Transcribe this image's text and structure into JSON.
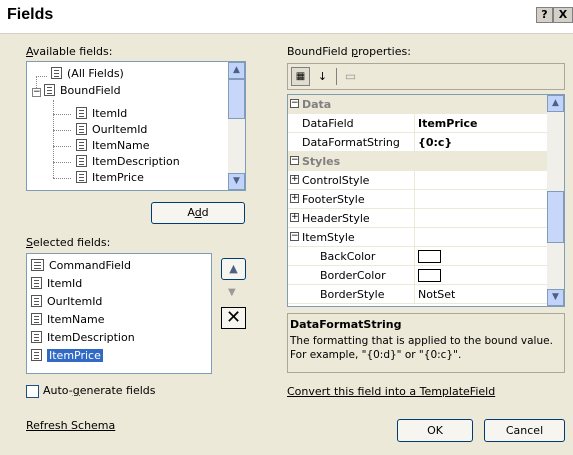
{
  "window": {
    "title": "Fields",
    "help_glyph": "?",
    "close_glyph": "X"
  },
  "available": {
    "label_accel": "A",
    "label_rest": "vailable fields:",
    "items": [
      "(All Fields)",
      "BoundField",
      "ItemId",
      "OurItemId",
      "ItemName",
      "ItemDescription",
      "ItemPrice"
    ],
    "add_pre": "A",
    "add_accel": "d",
    "add_post": "d"
  },
  "selected": {
    "label_accel": "S",
    "label_rest": "elected fields:",
    "items": [
      "CommandField",
      "ItemId",
      "OurItemId",
      "ItemName",
      "ItemDescription",
      "ItemPrice"
    ]
  },
  "autogen": {
    "pre": "Auto-",
    "accel": "g",
    "post": "enerate fields",
    "checked": false
  },
  "refresh_schema": "Refresh Schema",
  "properties": {
    "label_pre": "BoundField ",
    "label_accel": "p",
    "label_post": "roperties:",
    "rows": {
      "cat_data": "Data",
      "datafield_name": "DataField",
      "datafield_value": "ItemPrice",
      "dfs_name": "DataFormatString",
      "dfs_value": "{0:c}",
      "cat_styles": "Styles",
      "controlstyle": "ControlStyle",
      "footerstyle": "FooterStyle",
      "headerstyle": "HeaderStyle",
      "itemstyle": "ItemStyle",
      "backcolor": "BackColor",
      "bordercolor": "BorderColor",
      "borderstyle_name": "BorderStyle",
      "borderstyle_value": "NotSet"
    }
  },
  "description": {
    "title": "DataFormatString",
    "text": "The formatting that is applied to the bound value. For example, \"{0:d}\" or \"{0:c}\"."
  },
  "convert_link": "Convert this field into a TemplateField",
  "buttons": {
    "ok": "OK",
    "cancel": "Cancel"
  },
  "colors": {
    "selection": "#316ac5",
    "border": "#7f9db9",
    "dialog_bg": "#ece9d8"
  }
}
